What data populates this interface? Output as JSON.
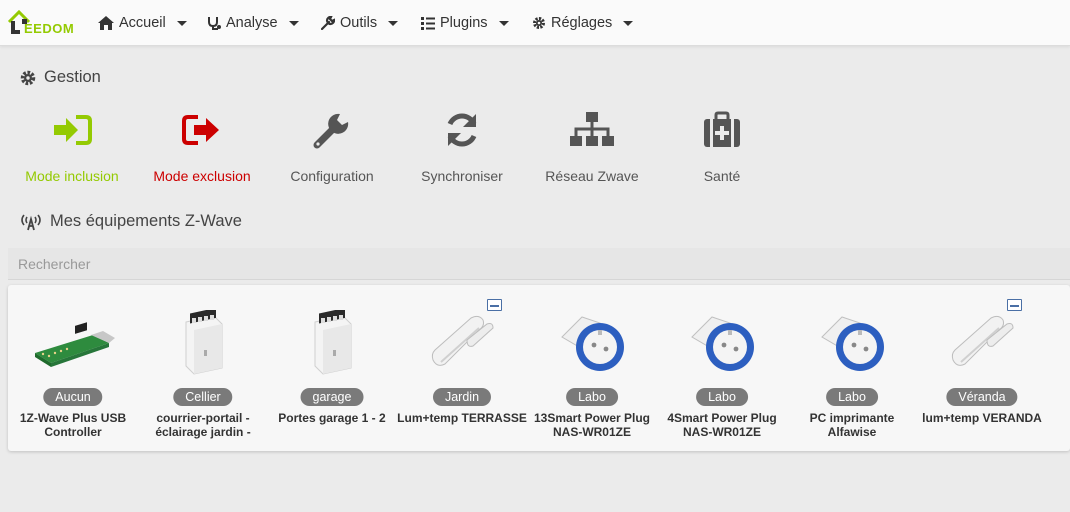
{
  "brand": {
    "logo_text": "EEDOM"
  },
  "nav": {
    "items": [
      {
        "label": "Accueil",
        "icon": "home-icon"
      },
      {
        "label": "Analyse",
        "icon": "stethoscope-icon"
      },
      {
        "label": "Outils",
        "icon": "wrench-icon"
      },
      {
        "label": "Plugins",
        "icon": "tasks-icon"
      },
      {
        "label": "Réglages",
        "icon": "cog-icon"
      }
    ]
  },
  "gestion": {
    "title": "Gestion",
    "actions": [
      {
        "label": "Mode inclusion",
        "icon": "sign-in-icon",
        "color": "#94ca02"
      },
      {
        "label": "Mode exclusion",
        "icon": "sign-out-icon",
        "color": "#cc0000"
      },
      {
        "label": "Configuration",
        "icon": "wrench-icon",
        "color": "#555555"
      },
      {
        "label": "Synchroniser",
        "icon": "refresh-icon",
        "color": "#555555"
      },
      {
        "label": "Réseau Zwave",
        "icon": "sitemap-icon",
        "color": "#555555"
      },
      {
        "label": "Santé",
        "icon": "medkit-icon",
        "color": "#555555"
      }
    ]
  },
  "equipements": {
    "title": "Mes équipements Z-Wave",
    "search_placeholder": "Rechercher",
    "items": [
      {
        "room": "Aucun",
        "name": "1Z-Wave Plus USB Controller",
        "image": "usb-stick",
        "zwave_badge": false
      },
      {
        "room": "Cellier",
        "name": "courrier-portail - éclairage jardin -",
        "image": "relay-module",
        "zwave_badge": false
      },
      {
        "room": "garage",
        "name": "Portes garage 1 - 2",
        "image": "relay-module",
        "zwave_badge": false
      },
      {
        "room": "Jardin",
        "name": "Lum+temp TERRASSE",
        "image": "door-sensor",
        "zwave_badge": true
      },
      {
        "room": "Labo",
        "name": "13Smart Power Plug NAS-WR01ZE",
        "image": "power-plug",
        "zwave_badge": false
      },
      {
        "room": "Labo",
        "name": "4Smart Power Plug NAS-WR01ZE",
        "image": "power-plug",
        "zwave_badge": false
      },
      {
        "room": "Labo",
        "name": "PC imprimante Alfawise",
        "image": "power-plug",
        "zwave_badge": false
      },
      {
        "room": "Véranda",
        "name": "lum+temp VERANDA",
        "image": "door-sensor",
        "zwave_badge": true
      }
    ]
  }
}
